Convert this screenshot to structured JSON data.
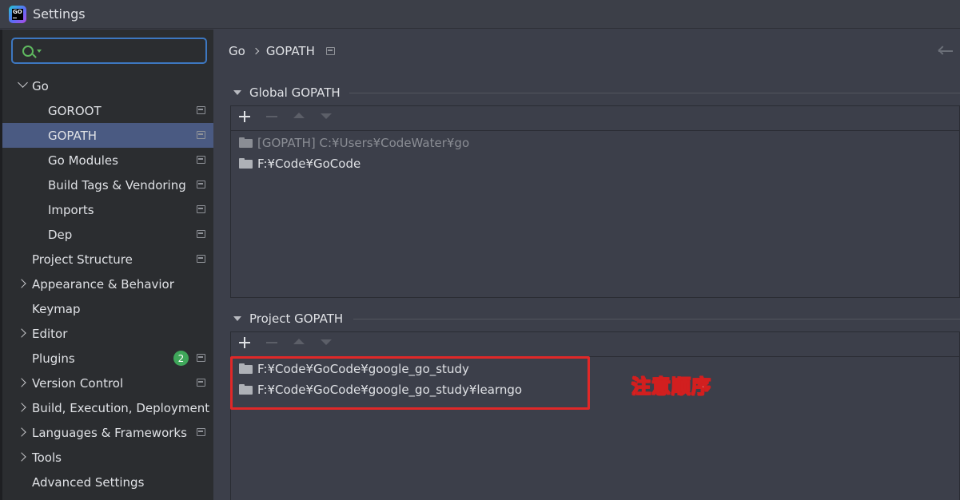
{
  "window": {
    "title": "Settings",
    "logo_text": "GO"
  },
  "search": {
    "value": "",
    "placeholder": ""
  },
  "sidebar": {
    "items": [
      {
        "label": "Go",
        "expanded": true,
        "indent": 0
      },
      {
        "label": "GOROOT",
        "indent": 1
      },
      {
        "label": "GOPATH",
        "indent": 1,
        "selected": true
      },
      {
        "label": "Go Modules",
        "indent": 1
      },
      {
        "label": "Build Tags & Vendoring",
        "indent": 1
      },
      {
        "label": "Imports",
        "indent": 1
      },
      {
        "label": "Dep",
        "indent": 1
      },
      {
        "label": "Project Structure",
        "indent": 0
      },
      {
        "label": "Appearance & Behavior",
        "indent": 0,
        "collapsed": true
      },
      {
        "label": "Keymap",
        "indent": 0
      },
      {
        "label": "Editor",
        "indent": 0,
        "collapsed": true
      },
      {
        "label": "Plugins",
        "indent": 0,
        "badge": "2"
      },
      {
        "label": "Version Control",
        "indent": 0,
        "collapsed": true
      },
      {
        "label": "Build, Execution, Deployment",
        "indent": 0,
        "collapsed": true
      },
      {
        "label": "Languages & Frameworks",
        "indent": 0,
        "collapsed": true
      },
      {
        "label": "Tools",
        "indent": 0,
        "collapsed": true
      },
      {
        "label": "Advanced Settings",
        "indent": 0
      }
    ]
  },
  "breadcrumb": {
    "parent": "Go",
    "current": "GOPATH"
  },
  "global_gopath": {
    "title": "Global GOPATH",
    "entries": [
      {
        "text": "[GOPATH] C:¥Users¥CodeWater¥go",
        "dimmed": true
      },
      {
        "text": "F:¥Code¥GoCode",
        "dimmed": false
      }
    ]
  },
  "project_gopath": {
    "title": "Project GOPATH",
    "entries": [
      {
        "text": "F:¥Code¥GoCode¥google_go_study"
      },
      {
        "text": "F:¥Code¥GoCode¥google_go_study¥learngo"
      }
    ]
  },
  "annotation": {
    "text": "注意顺序",
    "color": "#e02828"
  },
  "colors": {
    "selected": "#4a5a82",
    "accent": "#3d77c0",
    "badge": "#3fa75a"
  }
}
